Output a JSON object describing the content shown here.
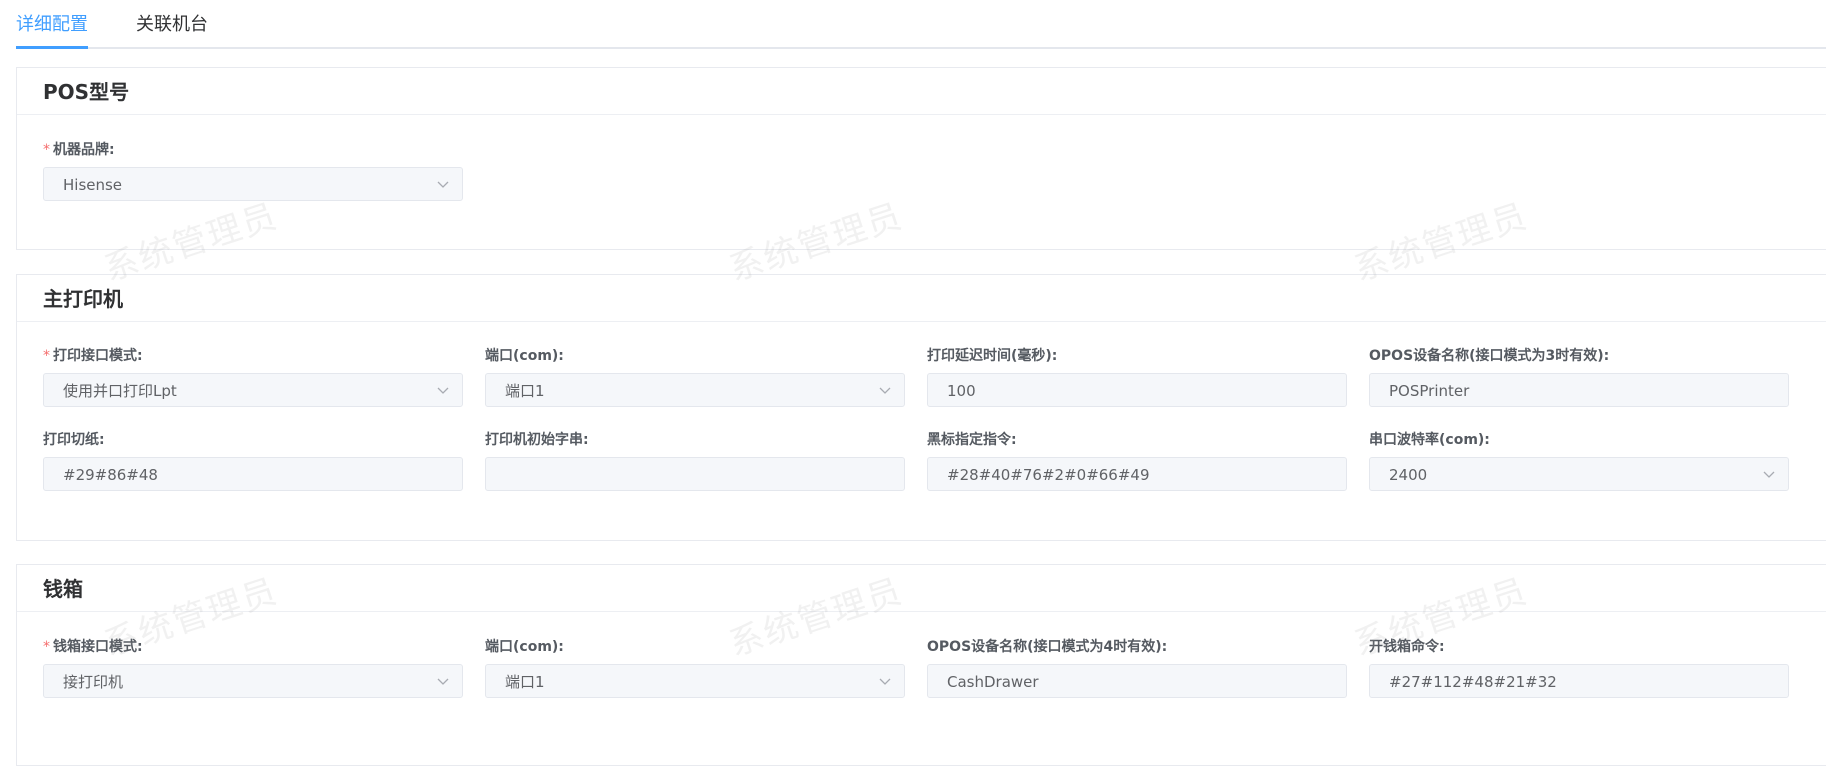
{
  "tabs": [
    {
      "label": "详细配置",
      "active": true
    },
    {
      "label": "关联机台",
      "active": false
    }
  ],
  "accent_color": "#409eff",
  "watermark": "系统管理员",
  "sections": {
    "pos": {
      "title": "POS型号",
      "brand": {
        "label": "机器品牌:",
        "required": true,
        "value": "Hisense",
        "type": "select"
      }
    },
    "printer": {
      "title": "主打印机",
      "interface_mode": {
        "label": "打印接口模式:",
        "required": true,
        "value": "使用并口打印Lpt",
        "type": "select"
      },
      "port": {
        "label": "端口(com):",
        "value": "端口1",
        "type": "select"
      },
      "delay": {
        "label": "打印延迟时间(毫秒):",
        "value": "100",
        "type": "input"
      },
      "opos_name": {
        "label": "OPOS设备名称(接口模式为3时有效):",
        "value": "POSPrinter",
        "type": "input"
      },
      "cut_paper": {
        "label": "打印切纸:",
        "value": "#29#86#48",
        "type": "input"
      },
      "init_string": {
        "label": "打印机初始字串:",
        "value": "",
        "type": "input"
      },
      "black_mark": {
        "label": "黑标指定指令:",
        "value": "#28#40#76#2#0#66#49",
        "type": "input"
      },
      "baud_rate": {
        "label": "串口波特率(com):",
        "value": "2400",
        "type": "select"
      }
    },
    "cashbox": {
      "title": "钱箱",
      "interface_mode": {
        "label": "钱箱接口模式:",
        "required": true,
        "value": "接打印机",
        "type": "select"
      },
      "port": {
        "label": "端口(com):",
        "value": "端口1",
        "type": "select"
      },
      "opos_name": {
        "label": "OPOS设备名称(接口模式为4时有效):",
        "value": "CashDrawer",
        "type": "input"
      },
      "open_command": {
        "label": "开钱箱命令:",
        "value": "#27#112#48#21#32",
        "type": "input"
      }
    }
  }
}
